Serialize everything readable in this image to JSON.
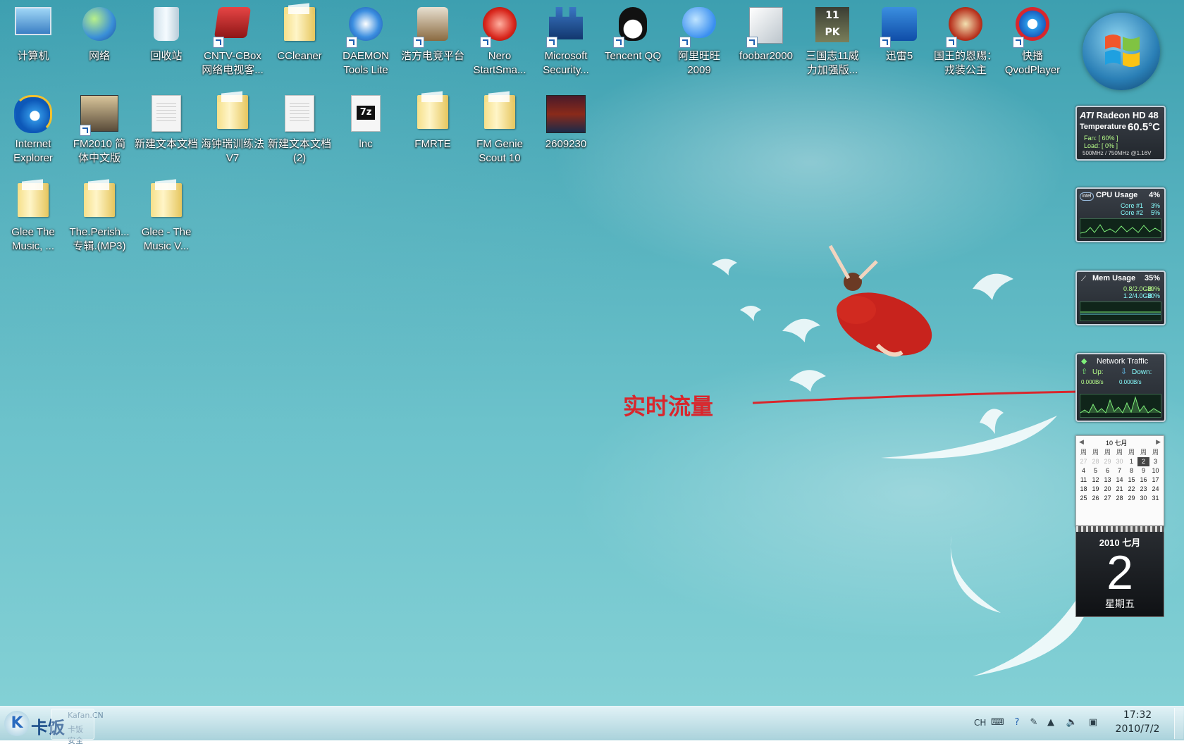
{
  "desktop": {
    "icons_row1": [
      {
        "name": "computer",
        "label": "计算机"
      },
      {
        "name": "network",
        "label": "网络"
      },
      {
        "name": "recycle-bin",
        "label": "回收站"
      },
      {
        "name": "cntv-cbox",
        "label": "CNTV-CBox\n网络电视客..."
      },
      {
        "name": "ccleaner",
        "label": "CCleaner"
      },
      {
        "name": "daemon-tools",
        "label": "DAEMON\nTools Lite"
      },
      {
        "name": "haofang",
        "label": "浩方电竞平台"
      },
      {
        "name": "nero",
        "label": "Nero\nStartSma..."
      },
      {
        "name": "ms-security",
        "label": "Microsoft\nSecurity..."
      },
      {
        "name": "tencent-qq",
        "label": "Tencent QQ"
      },
      {
        "name": "aliwangwang",
        "label": "阿里旺旺\n2009"
      },
      {
        "name": "foobar2000",
        "label": "foobar2000"
      },
      {
        "name": "sanguozhi",
        "label": "三国志11威\n力加强版..."
      },
      {
        "name": "xunlei",
        "label": "迅雷5"
      },
      {
        "name": "king-game",
        "label": "国王的恩赐：\n戎装公主"
      },
      {
        "name": "qvodplayer",
        "label": "快播\nQvodPlayer"
      }
    ],
    "icons_row2": [
      {
        "name": "internet-explorer",
        "label": "Internet\nExplorer"
      },
      {
        "name": "fm2010",
        "label": "FM2010 简\n体中文版"
      },
      {
        "name": "new-text-doc",
        "label": "新建文本文档"
      },
      {
        "name": "training-folder",
        "label": "海钟瑞训练法\nV7"
      },
      {
        "name": "new-text-doc-2",
        "label": "新建文本文档\n(2)"
      },
      {
        "name": "inc",
        "label": "lnc"
      },
      {
        "name": "fmrte",
        "label": "FMRTE"
      },
      {
        "name": "fm-genie",
        "label": "FM Genie\nScout 10"
      },
      {
        "name": "image-2609230",
        "label": "2609230"
      }
    ],
    "icons_row3": [
      {
        "name": "glee-music",
        "label": "Glee The\nMusic, ..."
      },
      {
        "name": "the-perish",
        "label": "The.Perish...\n专辑.(MP3)"
      },
      {
        "name": "glee-music-v",
        "label": "Glee - The\nMusic V..."
      }
    ],
    "annotation": "实时流量"
  },
  "gadgets": {
    "gpu": {
      "title": "Radeon HD 48",
      "brand": "ATI",
      "temp_label": "Temperature",
      "temp": "60.5°C",
      "fan": "Fan: [ 60% ]",
      "load": "Load: [ 0% ]",
      "clocks": "500MHz / 750MHz @1.16V"
    },
    "cpu": {
      "title": "CPU Usage",
      "value": "4%",
      "core1": "Core #1",
      "core1_val": "3%",
      "core2": "Core #2",
      "core2_val": "5%",
      "brand": "intel"
    },
    "mem": {
      "title": "Mem Usage",
      "value": "35%",
      "ram": "0.8/2.0GB",
      "ram_pct": "39%",
      "page": "1.2/4.0GB",
      "page_pct": "30%"
    },
    "net": {
      "title": "Network Traffic",
      "up_label": "Up:",
      "down_label": "Down:",
      "up_val": "0.000B/s",
      "down_val": "0.000B/s"
    },
    "calendar": {
      "header": "10 七月",
      "weekday_head": [
        "周",
        "周",
        "周",
        "周",
        "周",
        "周",
        "周"
      ],
      "days": [
        "27",
        "28",
        "29",
        "30",
        "1",
        "2",
        "3",
        "4",
        "5",
        "6",
        "7",
        "8",
        "9",
        "10",
        "11",
        "12",
        "13",
        "14",
        "15",
        "16",
        "17",
        "18",
        "19",
        "20",
        "21",
        "22",
        "23",
        "24",
        "25",
        "26",
        "27",
        "28",
        "29",
        "30",
        "31"
      ],
      "dim_count": 4,
      "today_index": 5
    },
    "date_tile": {
      "year_month": "2010 七月",
      "day": "2",
      "weekday": "星期五"
    }
  },
  "taskbar": {
    "start_brand": "卡饭",
    "start_watermark1": "Kafan.CN",
    "start_watermark2": "卡饭安全",
    "lang": "CH",
    "time": "17:32",
    "date": "2010/7/2"
  },
  "colors": {
    "annotation": "#d9262c",
    "accent": "#1f5fb0"
  }
}
